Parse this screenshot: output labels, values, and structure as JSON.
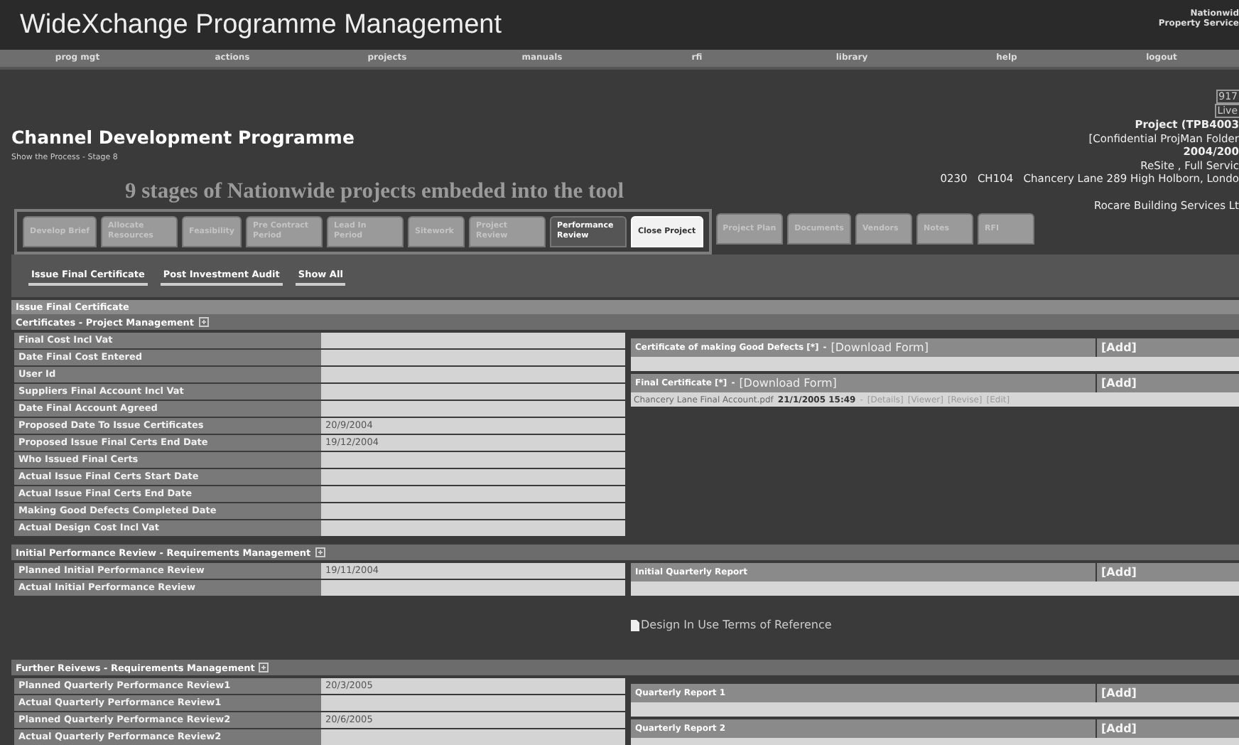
{
  "header": {
    "title": "WideXchange Programme Management",
    "brand": [
      "Nationwid",
      "Property Service"
    ]
  },
  "nav": [
    "prog mgt",
    "actions",
    "projects",
    "manuals",
    "rfi",
    "library",
    "help",
    "logout"
  ],
  "programme": {
    "title": "Channel Development Programme",
    "subtitle": "Show the Process - Stage 8",
    "annotation": "9 stages of Nationwide projects embeded into the tool"
  },
  "project_info": {
    "badges": [
      "917",
      "Live"
    ],
    "lines": [
      {
        "text": "Project (TPB4003",
        "bold": true
      },
      {
        "text": "[Confidential ProjMan Folder",
        "bold": false
      },
      {
        "text": "2004/200",
        "bold": true
      },
      {
        "text": "ReSite , Full Servic",
        "bold": false
      },
      {
        "text": "0230   CH104   Chancery Lane 289 High Holborn, Londo",
        "bold": false
      }
    ],
    "contractor": "Rocare Building Services Lt"
  },
  "stages": [
    {
      "label": "Develop Brief",
      "selected": false,
      "highlighted": false
    },
    {
      "label": "Allocate Resources",
      "selected": false,
      "highlighted": false
    },
    {
      "label": "Feasibility",
      "selected": false,
      "highlighted": false
    },
    {
      "label": "Pre Contract Period",
      "selected": false,
      "highlighted": false
    },
    {
      "label": "Lead In Period",
      "selected": false,
      "highlighted": false
    },
    {
      "label": "Sitework",
      "selected": false,
      "highlighted": false
    },
    {
      "label": "Project Review",
      "selected": false,
      "highlighted": false
    },
    {
      "label": "Performance Review",
      "selected": false,
      "highlighted": true
    },
    {
      "label": "Close Project",
      "selected": true,
      "highlighted": false
    }
  ],
  "tabs": [
    {
      "label": "Project Plan",
      "selected": false,
      "highlighted": false
    },
    {
      "label": "Documents",
      "selected": false,
      "highlighted": false
    },
    {
      "label": "Vendors",
      "selected": false,
      "highlighted": false
    },
    {
      "label": "Notes",
      "selected": false,
      "highlighted": false
    },
    {
      "label": "RFI",
      "selected": false,
      "highlighted": false
    }
  ],
  "subnav": [
    "Issue Final Certificate",
    "Post Investment Audit",
    "Show All"
  ],
  "page_title": "Issue Final Certificate",
  "sections": [
    {
      "title": "Certificates - Project Management",
      "rows": [
        {
          "label": "Final Cost Incl Vat",
          "value": ""
        },
        {
          "label": "Date Final Cost Entered",
          "value": ""
        },
        {
          "label": "User Id",
          "value": ""
        },
        {
          "label": "Suppliers Final Account Incl Vat",
          "value": ""
        },
        {
          "label": "Date Final Account Agreed",
          "value": ""
        },
        {
          "label": "Proposed Date To Issue Certificates",
          "value": "20/9/2004"
        },
        {
          "label": "Proposed Issue Final Certs End Date",
          "value": "19/12/2004"
        },
        {
          "label": "Who Issued Final Certs",
          "value": ""
        },
        {
          "label": "Actual Issue Final Certs Start Date",
          "value": ""
        },
        {
          "label": "Actual Issue Final Certs End Date",
          "value": ""
        },
        {
          "label": "Making Good Defects Completed Date",
          "value": ""
        },
        {
          "label": "Actual Design Cost Incl Vat",
          "value": ""
        }
      ],
      "panels": [
        {
          "title": "Certificate of making Good Defects [*]",
          "separator": "-",
          "download": "[Download Form]",
          "add": "[Add]"
        },
        {
          "title": "Final Certificate [*]",
          "separator": "-",
          "download": "[Download Form]",
          "add": "[Add]",
          "files": [
            {
              "name": "Chancery Lane Final Account.pdf",
              "date": "21/1/2005 15:49",
              "separator": "-",
              "actions": [
                "[Details]",
                "[Viewer]",
                "[Revise]",
                "[Edit]"
              ]
            }
          ]
        }
      ]
    },
    {
      "title": "Initial Performance Review - Requirements Management",
      "rows": [
        {
          "label": "Planned Initial Performance Review",
          "value": "19/11/2004"
        },
        {
          "label": "Actual Initial Performance Review",
          "value": ""
        }
      ],
      "panels": [
        {
          "title": "Initial Quarterly Report",
          "add": "[Add]"
        }
      ],
      "document": "Design In Use Terms of Reference"
    },
    {
      "title": "Further Reivews - Requirements Management",
      "rows": [
        {
          "label": "Planned Quarterly Performance Review1",
          "value": "20/3/2005"
        },
        {
          "label": "Actual Quarterly Performance Review1",
          "value": ""
        },
        {
          "label": "Planned Quarterly Performance Review2",
          "value": "20/6/2005"
        },
        {
          "label": "Actual Quarterly Performance Review2",
          "value": ""
        }
      ],
      "panels": [
        {
          "title": "Quarterly Report 1",
          "add": "[Add]"
        },
        {
          "title": "Quarterly Report 2",
          "add": "[Add]"
        }
      ]
    }
  ]
}
